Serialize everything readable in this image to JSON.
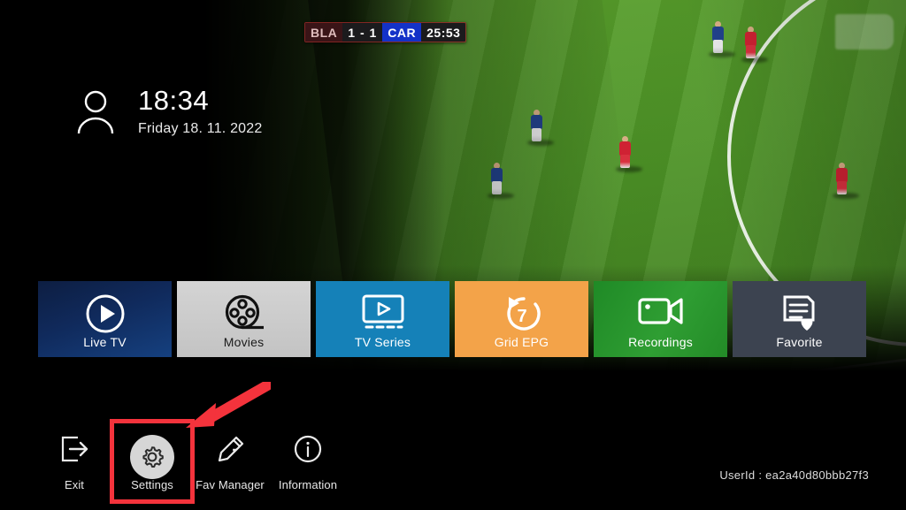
{
  "app": {
    "userid_label": "UserId : ea2a40d80bbb27f3"
  },
  "scoreboard": {
    "home_team": "BLA",
    "score": "1 - 1",
    "away_team": "CAR",
    "clock": "25:53"
  },
  "status": {
    "user_icon": "user-icon",
    "time": "18:34",
    "date": "Friday 18. 11. 2022"
  },
  "tiles": [
    {
      "label": "Live TV",
      "icon": "play-circle-icon",
      "color": "#15407f"
    },
    {
      "label": "Movies",
      "icon": "film-reel-icon",
      "color": "#c8c8c8"
    },
    {
      "label": "TV Series",
      "icon": "tv-play-icon",
      "color": "#1581b8"
    },
    {
      "label": "Grid EPG",
      "icon": "epg-seven-icon",
      "color": "#f3a349"
    },
    {
      "label": "Recordings",
      "icon": "video-camera-icon",
      "color": "#2f9e33"
    },
    {
      "label": "Favorite",
      "icon": "list-heart-icon",
      "color": "#3c4350"
    }
  ],
  "bottom_bar": [
    {
      "label": "Exit",
      "icon": "exit-icon",
      "selected": false
    },
    {
      "label": "Settings",
      "icon": "gear-icon",
      "selected": true
    },
    {
      "label": "Fav Manager",
      "icon": "pencil-edit-icon",
      "selected": false
    },
    {
      "label": "Information",
      "icon": "info-circle-icon",
      "selected": false
    }
  ],
  "annotation": {
    "highlight_color": "#f4333c",
    "arrow": "red-arrow-pointing-to-settings"
  },
  "video": {
    "watermark": "channel-logo-watermark"
  }
}
